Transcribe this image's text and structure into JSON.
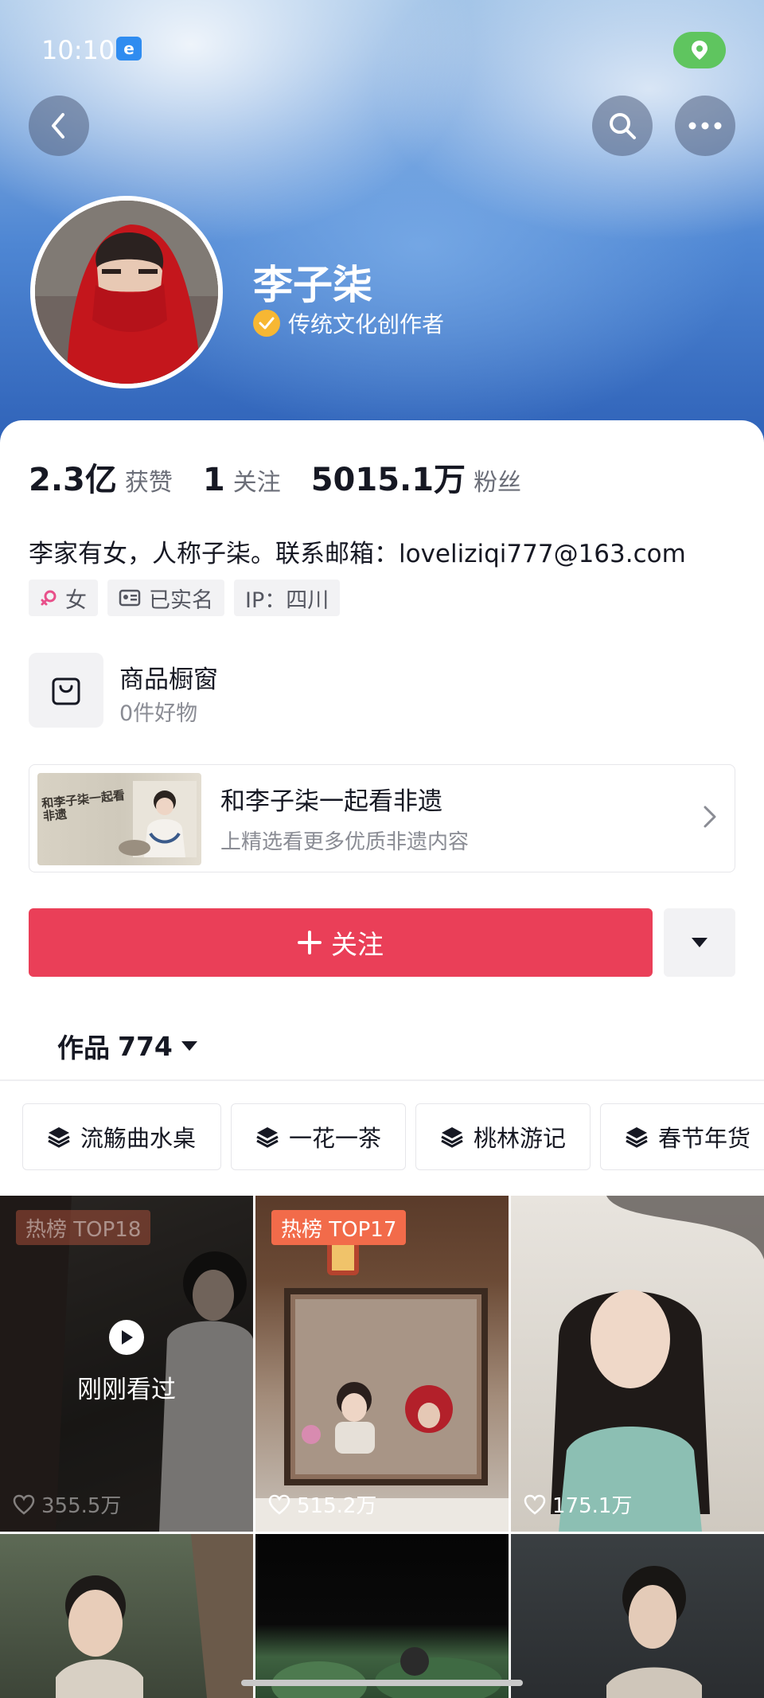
{
  "status_bar": {
    "time": "10:10",
    "app_icon": "browser-app-icon",
    "location_icon": "location-pin-icon"
  },
  "nav": {
    "back_icon": "chevron-left-icon",
    "search_icon": "search-icon",
    "more_icon": "more-dots-icon"
  },
  "profile": {
    "name": "李子柒",
    "verify_label": "传统文化创作者",
    "verify_icon": "check-badge-icon",
    "avatar": "avatar-photo"
  },
  "stats": [
    {
      "value": "2.3亿",
      "label": "获赞"
    },
    {
      "value": "1",
      "label": "关注"
    },
    {
      "value": "5015.1万",
      "label": "粉丝"
    }
  ],
  "bio": "李家有女，人称子柒。联系邮箱：loveliziqi777@163.com",
  "tags": [
    {
      "icon": "female-icon",
      "label": "女"
    },
    {
      "icon": "id-card-icon",
      "label": "已实名"
    },
    {
      "icon": "",
      "label": "IP：四川"
    }
  ],
  "shop": {
    "icon": "shopping-bag-icon",
    "title": "商品橱窗",
    "subtitle": "0件好物"
  },
  "promo": {
    "thumb_text": "和李子柒一起看非遗",
    "title": "和李子柒一起看非遗",
    "subtitle": "上精选看更多优质非遗内容",
    "arrow_icon": "chevron-right-icon"
  },
  "actions": {
    "follow_label": "关注",
    "follow_icon": "plus-icon",
    "dropdown_icon": "caret-down-icon"
  },
  "works": {
    "label": "作品",
    "count": "774",
    "caret_icon": "caret-down-icon"
  },
  "collections": [
    {
      "icon": "layers-icon",
      "label": "流觞曲水桌"
    },
    {
      "icon": "layers-icon",
      "label": "一花一茶"
    },
    {
      "icon": "layers-icon",
      "label": "桃林游记"
    },
    {
      "icon": "layers-icon",
      "label": "春节年货"
    }
  ],
  "videos": [
    {
      "badge": "热榜 TOP18",
      "likes": "355.5万",
      "watched_label": "刚刚看过",
      "dimmed": true
    },
    {
      "badge": "热榜 TOP17",
      "likes": "515.2万"
    },
    {
      "badge": "",
      "likes": "175.1万"
    },
    {
      "badge": "",
      "likes": ""
    },
    {
      "badge": "",
      "likes": ""
    },
    {
      "badge": "",
      "likes": ""
    }
  ],
  "colors": {
    "follow_red": "#ea3f58",
    "verify_gold": "#f7b733",
    "badge_orange": "#f26b4a",
    "banner_blue": "#4e86d3"
  }
}
